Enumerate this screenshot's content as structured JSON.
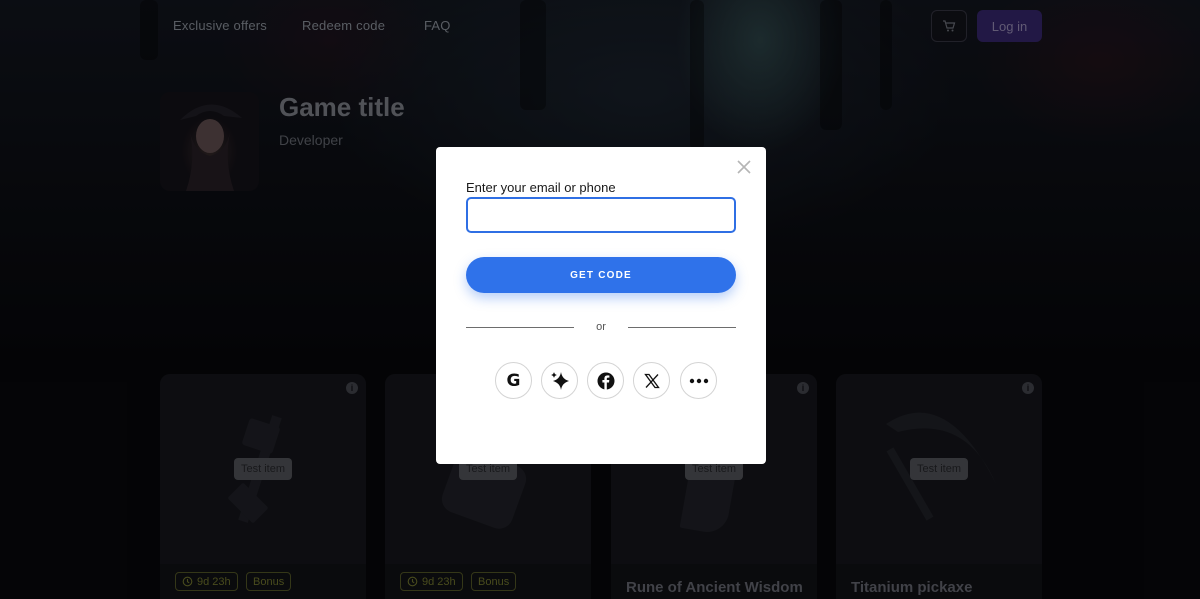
{
  "nav": {
    "links": [
      "Exclusive offers",
      "Redeem code",
      "FAQ"
    ],
    "login_label": "Log in"
  },
  "game": {
    "title": "Game title",
    "developer": "Developer"
  },
  "cards": [
    {
      "tag": "Test item",
      "timer": "9d 23h",
      "bonus": "Bonus",
      "name": ""
    },
    {
      "tag": "Test item",
      "timer": "9d 23h",
      "bonus": "Bonus",
      "name": ""
    },
    {
      "tag": "Test item",
      "timer": "",
      "bonus": "",
      "name": "Rune of Ancient Wisdom"
    },
    {
      "tag": "Test item",
      "timer": "",
      "bonus": "",
      "name": "Titanium pickaxe"
    }
  ],
  "modal": {
    "email_label": "Enter your email or phone",
    "email_value": "",
    "email_placeholder": "",
    "get_code_label": "GET CODE",
    "divider_text": "or",
    "social": [
      "google-icon",
      "sparkle-icon",
      "facebook-icon",
      "x-icon",
      "more-icon"
    ]
  },
  "colors": {
    "accent": "#2f72ea",
    "login_bg": "#3c2a78",
    "badge": "#7d8232"
  }
}
